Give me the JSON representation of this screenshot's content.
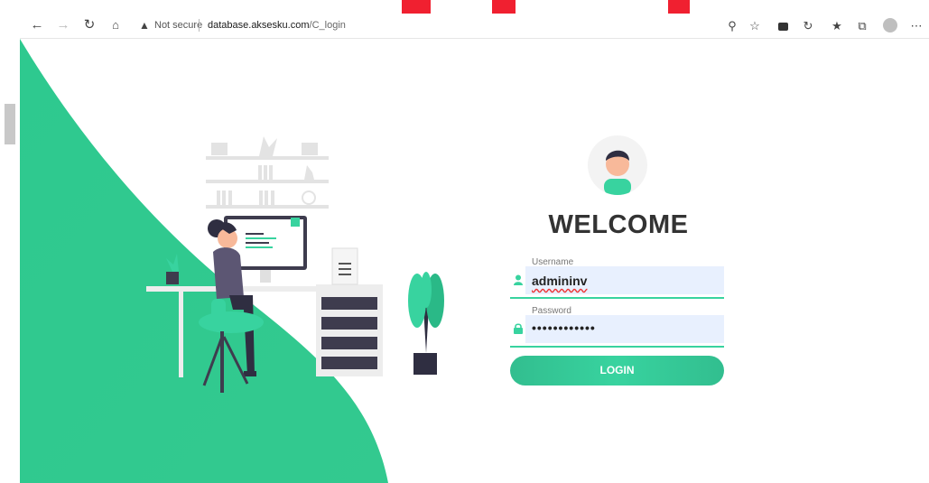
{
  "browser": {
    "back_icon": "arrow-left-icon",
    "forward_icon": "arrow-right-icon",
    "refresh_icon": "refresh-icon",
    "home_icon": "home-icon",
    "security_label": "Not secure",
    "url_domain": "database.aksesku.com",
    "url_path": "/C_login",
    "toolbar_icons": [
      "key-icon",
      "favorite-add-icon",
      "extension-icon",
      "sync-icon",
      "favorites-icon",
      "collections-icon",
      "profile-icon",
      "more-icon"
    ]
  },
  "login": {
    "title": "WELCOME",
    "username_label": "Username",
    "username_value": "admininv",
    "password_label": "Password",
    "password_value": "••••••••••••",
    "button_label": "LOGIN"
  },
  "colors": {
    "accent": "#38d39f",
    "accent_dark": "#32be8f",
    "input_bg": "#e8f0fe",
    "title": "#333333"
  }
}
